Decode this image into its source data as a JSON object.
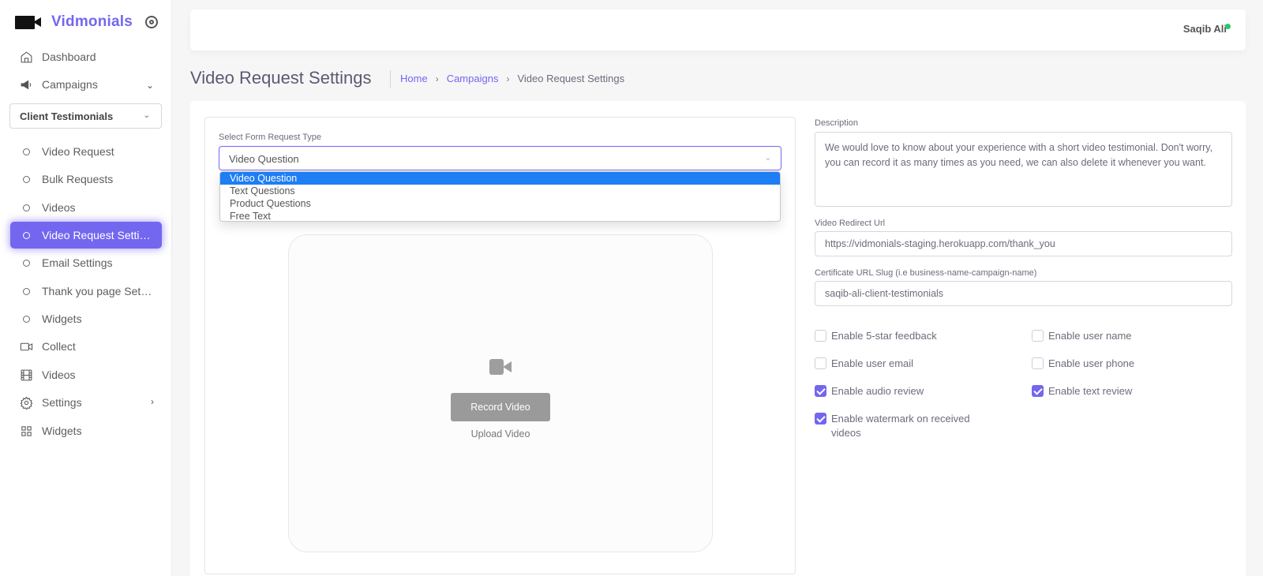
{
  "brand": {
    "name": "Vidmonials"
  },
  "sidebar": {
    "items": [
      {
        "label": "Dashboard",
        "icon": "home-icon"
      },
      {
        "label": "Campaigns",
        "icon": "megaphone-icon"
      },
      {
        "label": "Video Request",
        "icon": "circle-icon"
      },
      {
        "label": "Bulk Requests",
        "icon": "circle-icon"
      },
      {
        "label": "Videos",
        "icon": "circle-icon"
      },
      {
        "label": "Video Request Settings",
        "icon": "circle-icon"
      },
      {
        "label": "Email Settings",
        "icon": "circle-icon"
      },
      {
        "label": "Thank you page Settings",
        "icon": "circle-icon"
      },
      {
        "label": "Widgets",
        "icon": "circle-icon"
      },
      {
        "label": "Collect",
        "icon": "video-icon"
      },
      {
        "label": "Videos",
        "icon": "film-icon"
      },
      {
        "label": "Settings",
        "icon": "gear-icon"
      },
      {
        "label": "Widgets",
        "icon": "grid-icon"
      }
    ],
    "campaign_select": "Client Testimonials"
  },
  "header": {
    "user": "Saqib Ali"
  },
  "page": {
    "title": "Video Request Settings",
    "breadcrumb": [
      "Home",
      "Campaigns",
      "Video Request Settings"
    ]
  },
  "form": {
    "request_type_label": "Select Form Request Type",
    "request_type_value": "Video Question",
    "options": [
      "Video Question",
      "Text Questions",
      "Product Questions",
      "Free Text"
    ],
    "record_label": "Record Video",
    "upload_label": "Upload Video"
  },
  "settings": {
    "description_label": "Description",
    "description": "We would love to know about your experience with a short video testimonial. Don't worry, you can record it as many times as you need, we can also delete it whenever you want.",
    "redirect_label": "Video Redirect Url",
    "redirect_url": "https://vidmonials-staging.herokuapp.com/thank_you",
    "slug_label": "Certificate URL Slug (i.e business-name-campaign-name)",
    "slug": "saqib-ali-client-testimonials",
    "checkboxes": [
      {
        "label": "Enable 5-star feedback",
        "checked": false
      },
      {
        "label": "Enable user name",
        "checked": false
      },
      {
        "label": "Enable user email",
        "checked": false
      },
      {
        "label": "Enable user phone",
        "checked": false
      },
      {
        "label": "Enable audio review",
        "checked": true
      },
      {
        "label": "Enable text review",
        "checked": true
      },
      {
        "label": "Enable watermark on received videos",
        "checked": true
      }
    ]
  },
  "colors": {
    "accent": "#7367f0",
    "online": "#28c76f",
    "selected_option": "#1e7ef4"
  }
}
